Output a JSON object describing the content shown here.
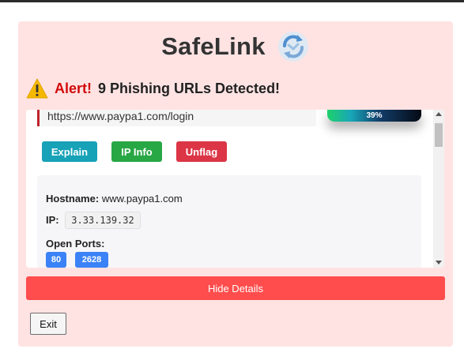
{
  "app": {
    "title": "SafeLink",
    "logo_icon": "refresh-shield-logo-icon"
  },
  "alert": {
    "icon": "warning-icon",
    "label": "Alert!",
    "message": "9 Phishing URLs Detected!"
  },
  "item": {
    "url": "https://www.paypa1.com/login",
    "confidence": "39%",
    "confidence_value": 0.39,
    "buttons": {
      "explain": "Explain",
      "ip_info": "IP Info",
      "unflag": "Unflag"
    },
    "details": {
      "hostname_label": "Hostname:",
      "hostname": "www.paypa1.com",
      "ip_label": "IP:",
      "ip": "3.33.139.32",
      "ports_label": "Open Ports:",
      "ports": [
        "80",
        "2628"
      ]
    }
  },
  "actions": {
    "hide_details": "Hide Details",
    "exit": "Exit"
  },
  "colors": {
    "panel_bg": "#ffe3e3",
    "alert_red": "#d10a0a",
    "explain": "#17a2b8",
    "ip_info": "#28a745",
    "unflag": "#dc3545",
    "port_badge": "#3b82f6",
    "hide_button": "#ff4d4d"
  }
}
